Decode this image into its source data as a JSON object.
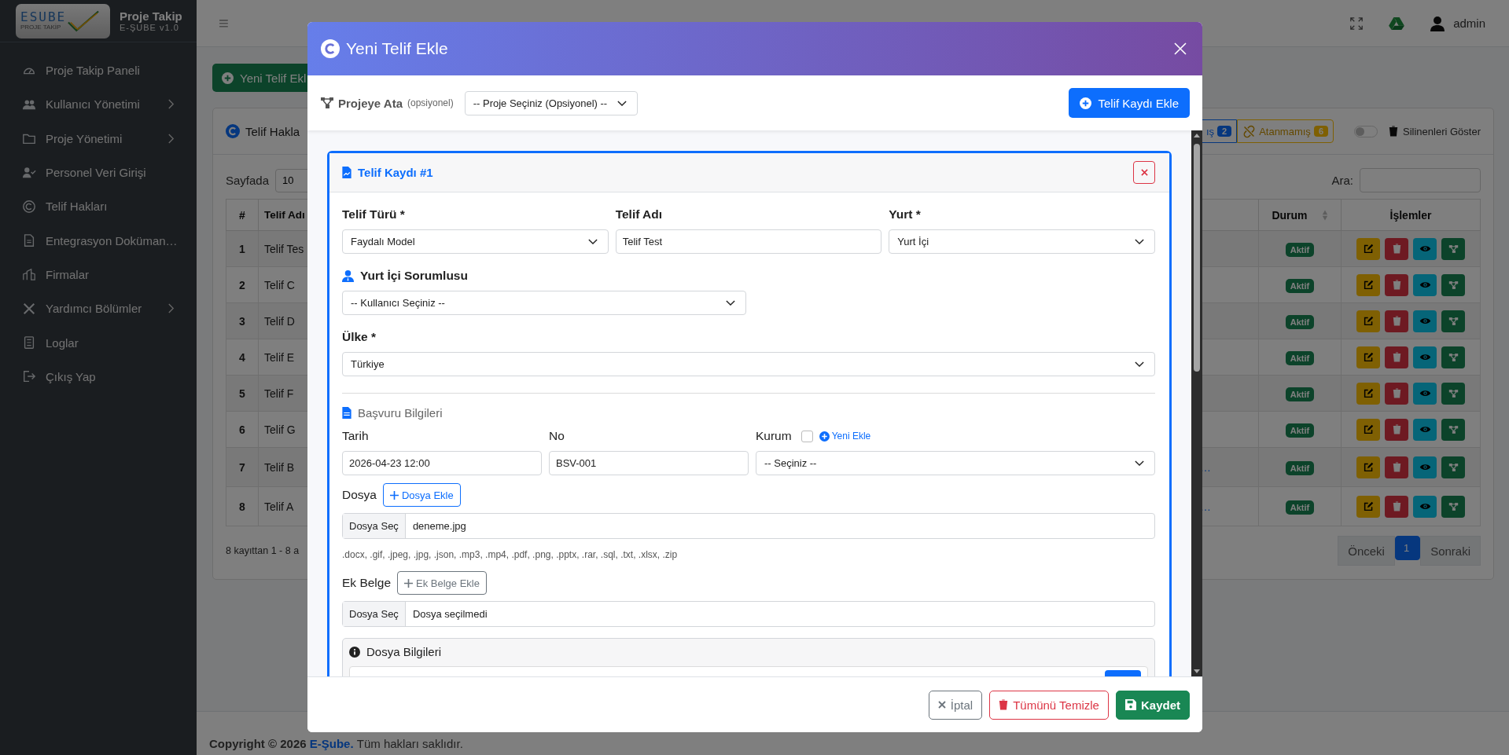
{
  "sidebar": {
    "logo": {
      "text": "ESUBE",
      "caption": "PROJE TAKİP"
    },
    "title": "Proje Takip",
    "subtitle": "E-ŞUBE v1.0",
    "items": [
      {
        "label": "Proje Takip Paneli",
        "submenu": false
      },
      {
        "label": "Kullanıcı Yönetimi",
        "submenu": true
      },
      {
        "label": "Proje Yönetimi",
        "submenu": true
      },
      {
        "label": "Personel Veri Girişi",
        "submenu": false
      },
      {
        "label": "Telif Hakları",
        "submenu": false
      },
      {
        "label": "Entegrasyon Doküman…",
        "submenu": false
      },
      {
        "label": "Firmalar",
        "submenu": false
      },
      {
        "label": "Yardımcı Bölümler",
        "submenu": true
      },
      {
        "label": "Loglar",
        "submenu": false
      },
      {
        "label": "Çıkış Yap",
        "submenu": false
      }
    ]
  },
  "topbar": {
    "menu_glyph": "≡",
    "user": "admin"
  },
  "page": {
    "new_button": "Yeni Telif Ekl",
    "card_title": "Telif Hakla",
    "filters": [
      {
        "label": "ış",
        "count": "2",
        "kind": "assigned"
      },
      {
        "label": "Atanmamış",
        "count": "6",
        "kind": "unassigned"
      }
    ],
    "deleted_toggle": {
      "label": "Silinenleri Göster",
      "on": false
    },
    "page_size_label": "Sayfada",
    "page_size": "10",
    "search_label": "Ara:",
    "table": {
      "columns": [
        "#",
        "Telif Adı",
        "Durum",
        "İşlemler"
      ],
      "rows": [
        {
          "number": "1",
          "name": "Telif Tes",
          "status": "Aktif"
        },
        {
          "number": "2",
          "name": "Telif C",
          "status": "Aktif"
        },
        {
          "number": "3",
          "name": "Telif D",
          "status": "Aktif"
        },
        {
          "number": "4",
          "name": "Telif E",
          "status": "Aktif"
        },
        {
          "number": "5",
          "name": "Telif F",
          "status": "Aktif"
        },
        {
          "number": "6",
          "name": "Telif G",
          "status": "Aktif"
        },
        {
          "number": "7",
          "name": "Telif B",
          "column_3": "…",
          "status": "Aktif"
        },
        {
          "number": "8",
          "name": "Telif A",
          "column_3": "…",
          "status": "Aktif"
        }
      ]
    },
    "info": "8 kayıttan 1 - 8 a",
    "pagination": [
      {
        "label": "Önceki",
        "selected": false
      },
      {
        "label": "1",
        "selected": true
      },
      {
        "label": "Sonraki",
        "selected": false
      }
    ]
  },
  "footer": {
    "copyright": "Copyright © 2026",
    "link": "E-Şube.",
    "rest": "Tüm hakları saklıdır."
  },
  "modal": {
    "title": "Yeni Telif Ekle",
    "project_label": "Projeye Ata",
    "project_hint": "(opsiyonel)",
    "project_select": "-- Proje Seçiniz (Opsiyonel) --",
    "add_record_button": "Telif Kaydı Ekle",
    "records": [
      {
        "title": "Telif Kaydı #1",
        "type_label": "Telif Türü *",
        "type": "Faydalı Model",
        "name_label": "Telif Adı",
        "name": "Telif Test",
        "scope_label": "Yurt *",
        "scope": "Yurt İçi",
        "responsible_label": "Yurt İçi Sorumlusu",
        "responsible": "-- Kullanıcı Seçiniz --",
        "country_label": "Ülke *",
        "country": "Türkiye",
        "application_title": "Başvuru Bilgileri",
        "date_label": "Tarih",
        "date": "2026-04-23 12:00",
        "no_label": "No",
        "no": "BSV-001",
        "institution_label": "Kurum",
        "institution_checked": false,
        "new_link": "Yeni Ekle",
        "institution": "-- Seçiniz --",
        "file_label": "Dosya",
        "file_add": "Dosya Ekle",
        "file_button": "Dosya Seç",
        "file_name": "deneme.jpg",
        "extensions": ".docx, .gif, .jpeg, .jpg, .json, .mp3, .mp4, .pdf, .png, .pptx, .rar, .sql, .txt, .xlsx, .zip",
        "attachment_label": "Ek Belge",
        "attachment_add": "Ek Belge Ekle",
        "attachment_button": "Dosya Seç",
        "attachment_name": "Dosya seçilmedi",
        "file_info_title": "Dosya Bilgileri"
      }
    ],
    "footer_buttons": [
      {
        "label": "İptal",
        "kind": "cancel"
      },
      {
        "label": "Tümünü Temizle",
        "kind": "clear"
      },
      {
        "label": "Kaydet",
        "kind": "save"
      }
    ]
  }
}
